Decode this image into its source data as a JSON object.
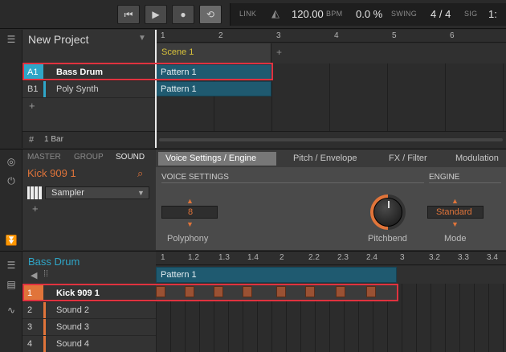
{
  "transport": {
    "link": "LINK",
    "tempo": "120.00",
    "bpm": "BPM",
    "swing_value": "0.0 %",
    "swing": "SWING",
    "sig_value": "4 / 4",
    "sig": "SIG",
    "position": "1:"
  },
  "arranger": {
    "project_title": "New Project",
    "ruler": [
      "1",
      "2",
      "3",
      "4",
      "5",
      "6"
    ],
    "scene": "Scene 1",
    "scene_add": "+",
    "groups": [
      {
        "index": "A1",
        "name": "Bass Drum",
        "color": "#2fa6c8"
      },
      {
        "index": "B1",
        "name": "Poly Synth",
        "color": "#2fa6c8"
      }
    ],
    "add": "+",
    "pattern_label": "Pattern 1",
    "length_icon": "#",
    "length": "1 Bar"
  },
  "control": {
    "tabs": {
      "master": "MASTER",
      "group": "GROUP",
      "sound": "SOUND"
    },
    "sound_name": "Kick 909 1",
    "plugin": "Sampler",
    "add": "+",
    "page_tabs": [
      "Voice Settings / Engine",
      "Pitch / Envelope",
      "FX / Filter",
      "Modulation"
    ],
    "voice_settings": "VOICE SETTINGS",
    "engine": "ENGINE",
    "polyphony_value": "8",
    "polyphony": "Polyphony",
    "pitchbend": "Pitchbend",
    "mode_value": "Standard",
    "mode": "Mode"
  },
  "pattern_editor": {
    "group_title": "Bass Drum",
    "ruler": [
      "1",
      "1.2",
      "1.3",
      "1.4",
      "2",
      "2.2",
      "2.3",
      "2.4",
      "3",
      "3.2",
      "3.3",
      "3.4"
    ],
    "pattern_label": "Pattern 1",
    "sounds": [
      {
        "index": "1",
        "name": "Kick 909 1"
      },
      {
        "index": "2",
        "name": "Sound 2"
      },
      {
        "index": "3",
        "name": "Sound 3"
      },
      {
        "index": "4",
        "name": "Sound 4"
      }
    ],
    "sound_color": "#e0743a"
  }
}
